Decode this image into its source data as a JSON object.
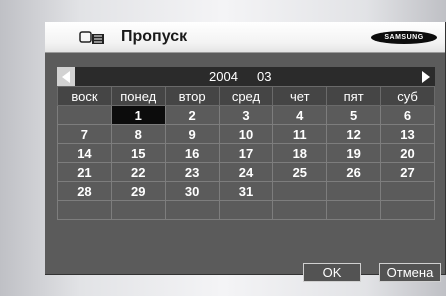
{
  "header": {
    "title": "Пропуск",
    "brand": "SAMSUNG",
    "icon": "card-reader-icon"
  },
  "nav": {
    "prev_icon": "arrow-left-icon",
    "next_icon": "arrow-right-icon",
    "year": "2004",
    "month": "03"
  },
  "calendar": {
    "weekdays": [
      "воск",
      "понед",
      "втор",
      "сред",
      "чет",
      "пят",
      "суб"
    ],
    "weeks": [
      [
        "",
        "1",
        "2",
        "3",
        "4",
        "5",
        "6"
      ],
      [
        "7",
        "8",
        "9",
        "10",
        "11",
        "12",
        "13"
      ],
      [
        "14",
        "15",
        "16",
        "17",
        "18",
        "19",
        "20"
      ],
      [
        "21",
        "22",
        "23",
        "24",
        "25",
        "26",
        "27"
      ],
      [
        "28",
        "29",
        "30",
        "31",
        "",
        "",
        ""
      ],
      [
        "",
        "",
        "",
        "",
        "",
        "",
        ""
      ]
    ],
    "selected_day": "1"
  },
  "buttons": {
    "ok_label": "OK",
    "cancel_label": "Отмена"
  }
}
